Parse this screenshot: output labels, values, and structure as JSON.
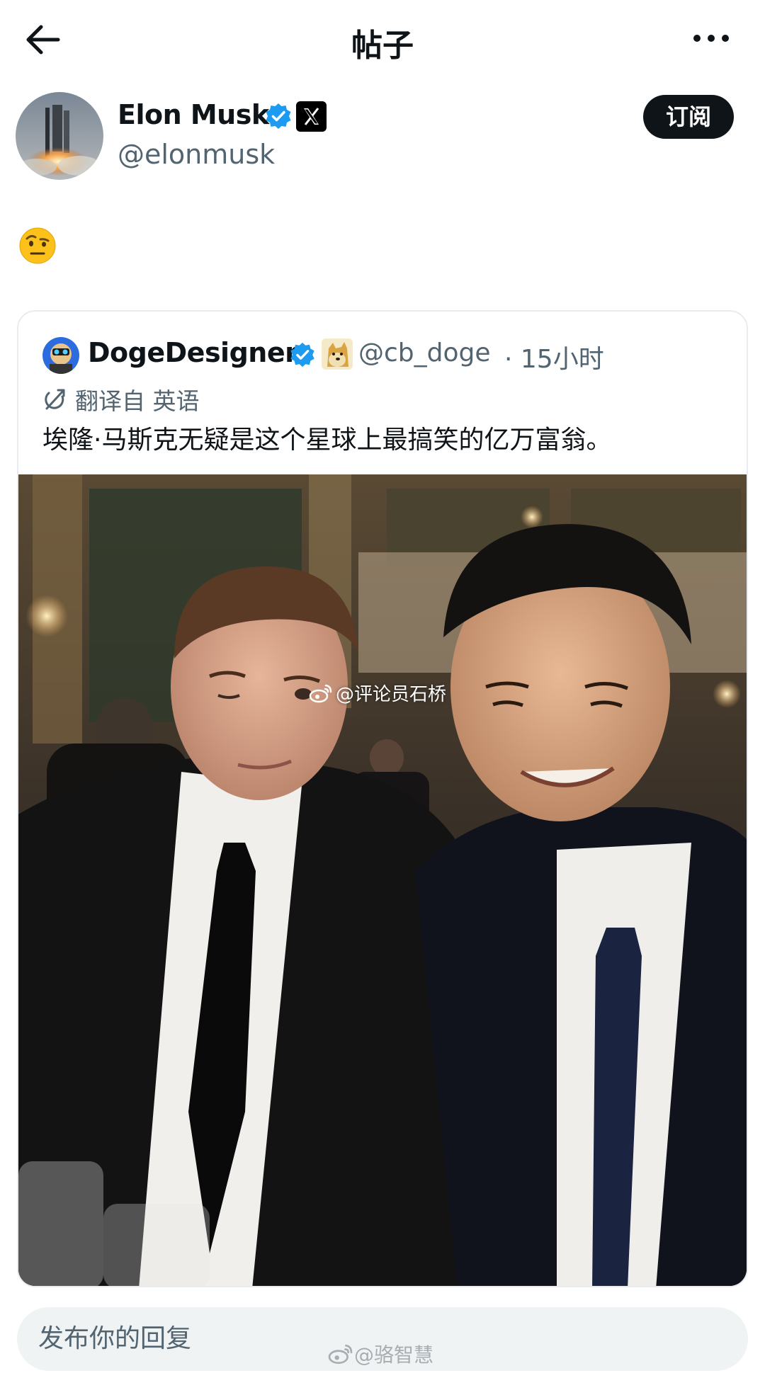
{
  "header": {
    "title": "帖子",
    "back_icon": "arrow-left-icon",
    "more_icon": "more-horizontal-icon"
  },
  "author": {
    "name": "Elon Musk",
    "handle": "@elonmusk",
    "verified": true,
    "platform_badge": "𝕏",
    "subscribe_label": "订阅"
  },
  "post": {
    "emoji": "raised-eyebrow-emoji"
  },
  "quoted_post": {
    "name": "DogeDesigner",
    "handle": "@cb_doge",
    "time": "· 15小时",
    "verified": true,
    "translate_label": "翻译自 英语",
    "text": "埃隆·马斯克无疑是这个星球上最搞笑的亿万富翁。",
    "photo_watermark": "@评论员石桥"
  },
  "reply": {
    "placeholder": "发布你的回复"
  },
  "page_watermark": "@骆智慧",
  "colors": {
    "accent": "#1d9bf0",
    "text_primary": "#0f1419",
    "text_secondary": "#536471",
    "border": "#e6ecf0",
    "button_dark": "#0f1419"
  }
}
